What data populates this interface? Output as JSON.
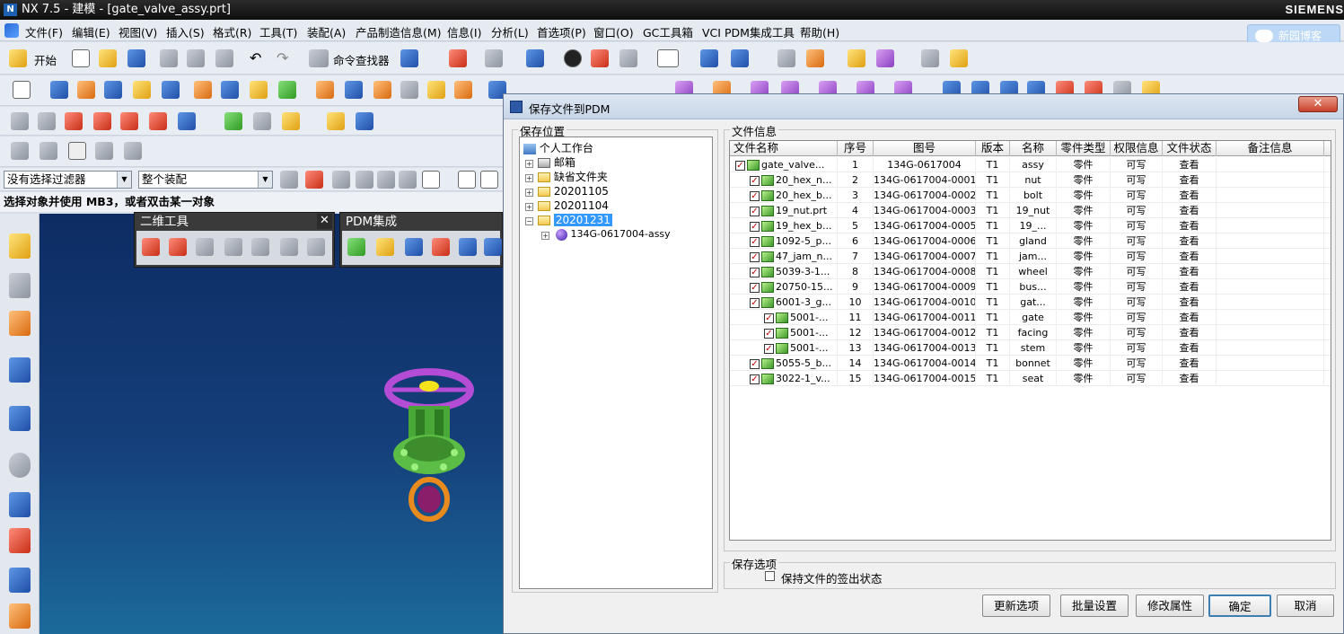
{
  "window": {
    "title": "NX 7.5 - 建模 - [gate_valve_assy.prt]",
    "brand": "SIEMENS"
  },
  "menu": [
    "文件(F)",
    "编辑(E)",
    "视图(V)",
    "插入(S)",
    "格式(R)",
    "工具(T)",
    "装配(A)",
    "产品制造信息(M)",
    "信息(I)",
    "分析(L)",
    "首选项(P)",
    "窗口(O)",
    "GC工具箱",
    "VCI PDM集成工具",
    "帮助(H)"
  ],
  "cloud_button": "新园博客",
  "toolbar": {
    "start": "开始",
    "cmd_finder": "命令查找器"
  },
  "filters": {
    "type_filter": "没有选择过滤器",
    "scope_filter": "整个装配"
  },
  "status": "选择对象并使用 MB3，或者双击某一对象",
  "floating": {
    "tools2d": "二维工具",
    "pdm": "PDM集成"
  },
  "dialog": {
    "title": "保存文件到PDM",
    "location_group": "保存位置",
    "fileinfo_group": "文件信息",
    "options_group": "保存选项",
    "keep_checkout": "保持文件的签出状态",
    "tree": {
      "root": "个人工作台",
      "nodes": [
        "邮箱",
        "缺省文件夹",
        "20201105",
        "20201104",
        "20201231"
      ],
      "child": "134G-0617004-assy"
    },
    "columns": [
      "文件名称",
      "序号",
      "图号",
      "版本",
      "名称",
      "零件类型",
      "权限信息",
      "文件状态",
      "备注信息"
    ],
    "rows": [
      {
        "file": "gate_valve...",
        "no": "1",
        "dwg": "134G-0617004",
        "ver": "T1",
        "name": "assy",
        "type": "零件",
        "perm": "可写",
        "state": "查看",
        "indent": 0
      },
      {
        "file": "20_hex_n...",
        "no": "2",
        "dwg": "134G-0617004-0001",
        "ver": "T1",
        "name": "nut",
        "type": "零件",
        "perm": "可写",
        "state": "查看",
        "indent": 1
      },
      {
        "file": "20_hex_b...",
        "no": "3",
        "dwg": "134G-0617004-0002",
        "ver": "T1",
        "name": "bolt",
        "type": "零件",
        "perm": "可写",
        "state": "查看",
        "indent": 1
      },
      {
        "file": "19_nut.prt",
        "no": "4",
        "dwg": "134G-0617004-0003",
        "ver": "T1",
        "name": "19_nut",
        "type": "零件",
        "perm": "可写",
        "state": "查看",
        "indent": 1
      },
      {
        "file": "19_hex_b...",
        "no": "5",
        "dwg": "134G-0617004-0005",
        "ver": "T1",
        "name": "19_...",
        "type": "零件",
        "perm": "可写",
        "state": "查看",
        "indent": 1
      },
      {
        "file": "1092-5_p...",
        "no": "6",
        "dwg": "134G-0617004-0006",
        "ver": "T1",
        "name": "gland",
        "type": "零件",
        "perm": "可写",
        "state": "查看",
        "indent": 1
      },
      {
        "file": "47_jam_n...",
        "no": "7",
        "dwg": "134G-0617004-0007",
        "ver": "T1",
        "name": "jam...",
        "type": "零件",
        "perm": "可写",
        "state": "查看",
        "indent": 1
      },
      {
        "file": "5039-3-1...",
        "no": "8",
        "dwg": "134G-0617004-0008",
        "ver": "T1",
        "name": "wheel",
        "type": "零件",
        "perm": "可写",
        "state": "查看",
        "indent": 1
      },
      {
        "file": "20750-15...",
        "no": "9",
        "dwg": "134G-0617004-0009",
        "ver": "T1",
        "name": "bus...",
        "type": "零件",
        "perm": "可写",
        "state": "查看",
        "indent": 1
      },
      {
        "file": "6001-3_g...",
        "no": "10",
        "dwg": "134G-0617004-0010",
        "ver": "T1",
        "name": "gat...",
        "type": "零件",
        "perm": "可写",
        "state": "查看",
        "indent": 1
      },
      {
        "file": "5001-...",
        "no": "11",
        "dwg": "134G-0617004-0011",
        "ver": "T1",
        "name": "gate",
        "type": "零件",
        "perm": "可写",
        "state": "查看",
        "indent": 2
      },
      {
        "file": "5001-...",
        "no": "12",
        "dwg": "134G-0617004-0012",
        "ver": "T1",
        "name": "facing",
        "type": "零件",
        "perm": "可写",
        "state": "查看",
        "indent": 2
      },
      {
        "file": "5001-...",
        "no": "13",
        "dwg": "134G-0617004-0013",
        "ver": "T1",
        "name": "stem",
        "type": "零件",
        "perm": "可写",
        "state": "查看",
        "indent": 2
      },
      {
        "file": "5055-5_b...",
        "no": "14",
        "dwg": "134G-0617004-0014",
        "ver": "T1",
        "name": "bonnet",
        "type": "零件",
        "perm": "可写",
        "state": "查看",
        "indent": 1
      },
      {
        "file": "3022-1_v...",
        "no": "15",
        "dwg": "134G-0617004-0015",
        "ver": "T1",
        "name": "seat",
        "type": "零件",
        "perm": "可写",
        "state": "查看",
        "indent": 1
      }
    ],
    "buttons": {
      "update": "更新选项",
      "batch": "批量设置",
      "modify": "修改属性",
      "ok": "确定",
      "cancel": "取消"
    }
  }
}
